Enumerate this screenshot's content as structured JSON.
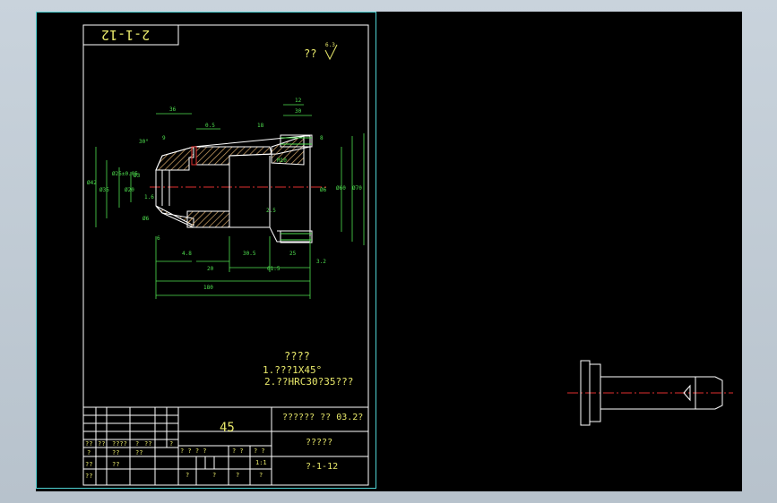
{
  "sheet": {
    "drawing_number_flipped": "2-1-12",
    "roughness_prefix": "??",
    "roughness_value": "6.3"
  },
  "notes": {
    "title": "????",
    "line1": "1.???1X45°",
    "line2": "2.??HRC30?35???"
  },
  "dimensions": {
    "d_top_1": "36",
    "d_top_2": "0.5",
    "d_top_3": "18",
    "d_top_4": "30",
    "d_top_5": "12",
    "d_angle": "30°",
    "d_chamfer_l": "9",
    "d_chamfer_r": "8",
    "d_left_1": "Ø42",
    "d_left_2": "Ø35",
    "d_left_3": "Ø25±0.05",
    "d_left_4": "Ø20",
    "d_left_5": "Ø3",
    "d_left_6": "Ø6",
    "d_hole": "1.6",
    "d_mid_1": "M10",
    "d_right_1": "Ø6",
    "d_right_2": "Ø60",
    "d_right_3": "Ø70",
    "d_small_1": "2.5",
    "d_bot_1": "6",
    "d_bot_2": "4.8",
    "d_bot_3": "20",
    "d_bot_4": "30.5",
    "d_bot_5": "61.5",
    "d_bot_6": "25",
    "d_total": "180",
    "d_ra": "3.2"
  },
  "title_block": {
    "material": "45",
    "cell_right_top": "?????? ?? 03.2?",
    "cell_right_mid": "?????",
    "drawing_code": "?-1-12",
    "hdr_1": "??",
    "hdr_2": "??",
    "hdr_3": "????",
    "hdr_4": "?",
    "hdr_5": "??",
    "hdr_6": "?",
    "row2_1": "?",
    "row2_2": "??",
    "row2_3": "??",
    "row3_1": "??",
    "row3_2": "??",
    "row4_1": "??",
    "stage_label": "? ? ? ?",
    "weight_label": "? ?",
    "scale_label": "? ?",
    "scale_value": "1:1",
    "bottom_1": "?",
    "bottom_2": "?",
    "bottom_3": "?",
    "bottom_4": "?"
  },
  "colors": {
    "frame": "#4fd1d1",
    "outline": "#ffffff",
    "dimension": "#4fe04f",
    "hatch": "#d6a86a",
    "text": "#e8e86a",
    "centerline": "#e03030",
    "background": "#000000"
  },
  "icons": {
    "roughness_mark": "surface-roughness-symbol"
  }
}
